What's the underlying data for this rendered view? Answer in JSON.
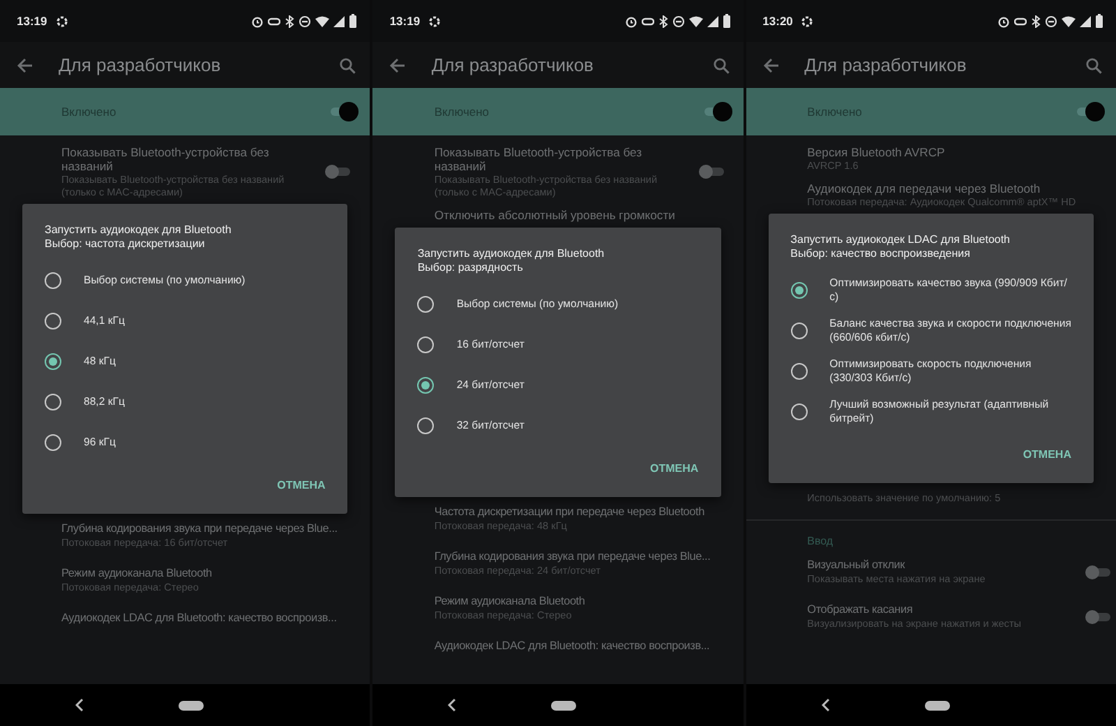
{
  "screens": [
    {
      "status_bar": {
        "time": "13:19"
      },
      "app_bar": {
        "title": "Для разработчиков"
      },
      "master_switch": {
        "label": "Включено",
        "on": true
      },
      "items_above": [
        {
          "kind": "toggle",
          "title": "Показывать Bluetooth-устройства без названий",
          "summary": "Показывать Bluetooth-устройства без названий (только с MAC-адресами)",
          "on": false
        }
      ],
      "dialog": {
        "title": "Запустить аудиокодек для Bluetooth",
        "subtitle": "Выбор: частота дискретизации",
        "options": [
          {
            "label": "Выбор системы (по умолчанию)",
            "selected": false
          },
          {
            "label": "44,1 кГц",
            "selected": false
          },
          {
            "label": "48 кГц",
            "selected": true
          },
          {
            "label": "88,2 кГц",
            "selected": false
          },
          {
            "label": "96 кГц",
            "selected": false
          }
        ],
        "cancel": "ОТМЕНА"
      },
      "items_below": [
        {
          "kind": "setting",
          "title": "Глубина кодирования звука при передаче через Blue...",
          "summary": "Потоковая передача: 16 бит/отсчет"
        },
        {
          "kind": "setting",
          "title": "Режим аудиоканала Bluetooth",
          "summary": "Потоковая передача: Стерео"
        },
        {
          "kind": "setting",
          "title": "Аудиокодек LDAC для Bluetooth: качество воспроизв..."
        }
      ]
    },
    {
      "status_bar": {
        "time": "13:19"
      },
      "app_bar": {
        "title": "Для разработчиков"
      },
      "master_switch": {
        "label": "Включено",
        "on": true
      },
      "items_above": [
        {
          "kind": "toggle",
          "title": "Показывать Bluetooth-устройства без названий",
          "summary": "Показывать Bluetooth-устройства без названий (только с MAC-адресами)",
          "on": false
        },
        {
          "kind": "setting",
          "title": "Отключить абсолютный уровень громкости"
        }
      ],
      "dialog": {
        "title": "Запустить аудиокодек для Bluetooth",
        "subtitle": "Выбор: разрядность",
        "options": [
          {
            "label": "Выбор системы (по умолчанию)",
            "selected": false
          },
          {
            "label": "16 бит/отсчет",
            "selected": false
          },
          {
            "label": "24 бит/отсчет",
            "selected": true
          },
          {
            "label": "32 бит/отсчет",
            "selected": false
          }
        ],
        "cancel": "ОТМЕНА"
      },
      "items_below": [
        {
          "kind": "setting",
          "title": "Частота дискретизации при передаче через Bluetooth",
          "summary": "Потоковая передача: 48 кГц"
        },
        {
          "kind": "setting",
          "title": "Глубина кодирования звука при передаче через Blue...",
          "summary": "Потоковая передача: 24 бит/отсчет"
        },
        {
          "kind": "setting",
          "title": "Режим аудиоканала Bluetooth",
          "summary": "Потоковая передача: Стерео"
        },
        {
          "kind": "setting",
          "title": "Аудиокодек LDAC для Bluetooth: качество воспроизв..."
        }
      ]
    },
    {
      "status_bar": {
        "time": "13:20"
      },
      "app_bar": {
        "title": "Для разработчиков"
      },
      "master_switch": {
        "label": "Включено",
        "on": true
      },
      "items_above": [
        {
          "kind": "setting",
          "title": "Версия Bluetooth AVRCP",
          "summary": "AVRCP 1.6"
        },
        {
          "kind": "setting",
          "title": "Аудиокодек для передачи через Bluetooth",
          "summary": "Потоковая передача: Аудиокодек Qualcomm® aptX™ HD"
        }
      ],
      "dialog": {
        "title": "Запустить аудиокодек LDAC для Bluetooth",
        "subtitle": "Выбор: качество воспроизведения",
        "options": [
          {
            "label": "Оптимизировать качество звука (990/909 Кбит/с)",
            "selected": true
          },
          {
            "label": "Баланс качества звука и скорости подключения (660/606 кбит/с)",
            "selected": false
          },
          {
            "label": "Оптимизировать скорость подключения (330/303 Кбит/с)",
            "selected": false
          },
          {
            "label": "Лучший возможный результат (адаптивный битрейт)",
            "selected": false
          }
        ],
        "cancel": "ОТМЕНА"
      },
      "items_below": [
        {
          "kind": "setting",
          "summary": "Использовать значение по умолчанию: 5"
        },
        {
          "kind": "divider"
        },
        {
          "kind": "header",
          "title": "Ввод"
        },
        {
          "kind": "toggle",
          "title": "Визуальный отклик",
          "summary": "Показывать места нажатия на экране",
          "on": false
        },
        {
          "kind": "toggle",
          "title": "Отображать касания",
          "summary": "Визуализировать на экране нажатия и жесты",
          "on": false
        }
      ]
    }
  ]
}
